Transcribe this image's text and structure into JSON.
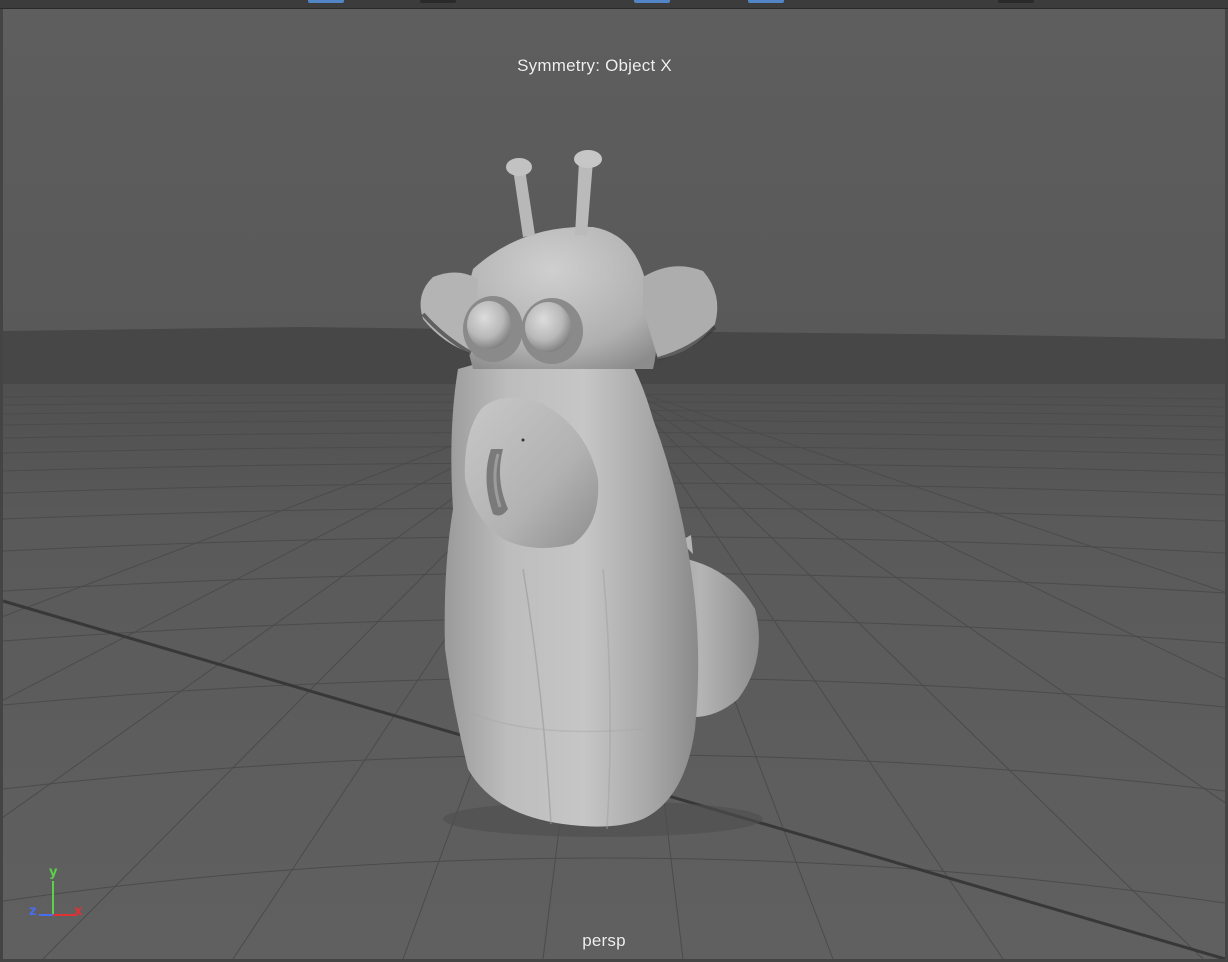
{
  "viewport": {
    "symmetry_label": "Symmetry: Object X",
    "camera_label": "persp"
  },
  "axis_gizmo": {
    "x_label": "x",
    "y_label": "y",
    "z_label": "z",
    "x_color": "#e03232",
    "y_color": "#5cd04a",
    "z_color": "#4a6cf0"
  },
  "colors": {
    "sky_top": "#5d5d5d",
    "sky_bottom": "#5a5a5a",
    "horizon_band": "#474747",
    "ground": "#5c5c5c",
    "grid_line": "#4a4a4a",
    "model_light": "#c4c4c4",
    "model_mid": "#a8a8a8",
    "model_dark": "#7e7e7e",
    "tab_active": "#5285c6",
    "tab_inactive": "#2a2a2a"
  }
}
